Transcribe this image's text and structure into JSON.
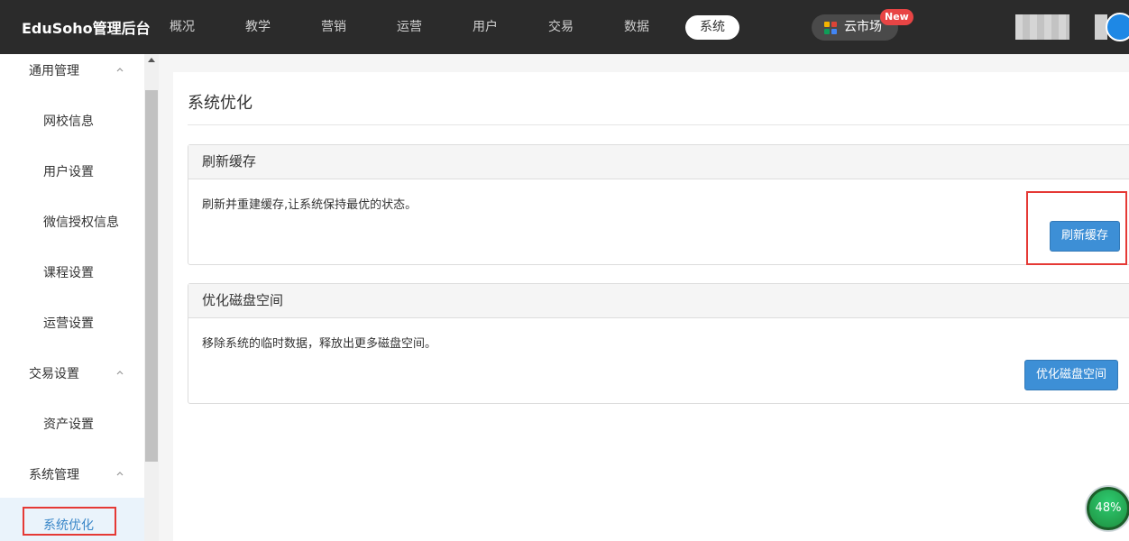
{
  "app": {
    "brand": "EduSoho管理后台"
  },
  "nav": {
    "items": [
      {
        "label": "概况"
      },
      {
        "label": "教学"
      },
      {
        "label": "营销"
      },
      {
        "label": "运营"
      },
      {
        "label": "用户"
      },
      {
        "label": "交易"
      },
      {
        "label": "数据"
      },
      {
        "label": "系统",
        "active": true
      }
    ],
    "market_label": "云市场",
    "new_badge": "New"
  },
  "sidebar": {
    "groups": [
      {
        "label": "通用管理",
        "items": [
          "网校信息",
          "用户设置",
          "微信授权信息",
          "课程设置",
          "运营设置"
        ]
      },
      {
        "label": "交易设置",
        "items": [
          "资产设置"
        ]
      },
      {
        "label": "系统管理",
        "items": [
          "系统优化"
        ]
      }
    ],
    "active_item": "系统优化"
  },
  "main": {
    "title": "系统优化",
    "panels": [
      {
        "heading": "刷新缓存",
        "description": "刷新并重建缓存,让系统保持最优的状态。",
        "button": "刷新缓存"
      },
      {
        "heading": "优化磁盘空间",
        "description": "移除系统的临时数据，释放出更多磁盘空间。",
        "button": "优化磁盘空间"
      }
    ]
  },
  "widget": {
    "label": "48%"
  },
  "colors": {
    "topbar": "#2b2b2b",
    "accent": "#3d8fd6",
    "highlight": "#e53935"
  }
}
